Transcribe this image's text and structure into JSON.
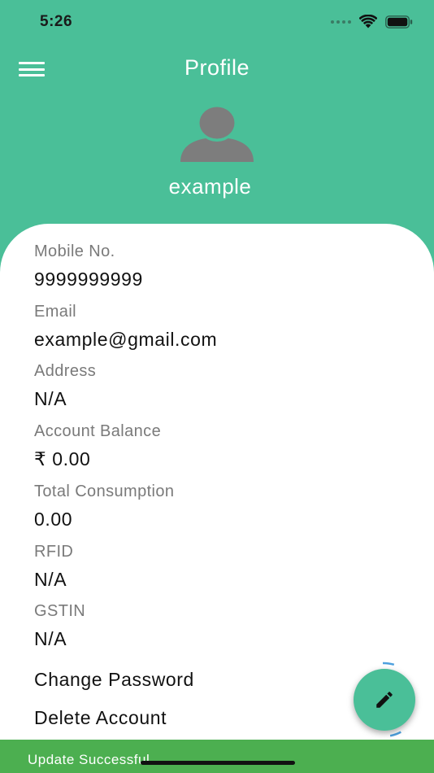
{
  "status_bar": {
    "time": "5:26"
  },
  "header": {
    "title": "Profile"
  },
  "user": {
    "name": "example"
  },
  "fields": [
    {
      "label": "Mobile No.",
      "value": "9999999999"
    },
    {
      "label": "Email",
      "value": "example@gmail.com"
    },
    {
      "label": "Address",
      "value": "N/A"
    },
    {
      "label": "Account Balance",
      "value": "₹ 0.00"
    },
    {
      "label": "Total Consumption",
      "value": "0.00"
    },
    {
      "label": "RFID",
      "value": "N/A"
    },
    {
      "label": "GSTIN",
      "value": "N/A"
    }
  ],
  "actions": {
    "change_password": "Change Password",
    "delete_account": "Delete Account"
  },
  "snackbar": {
    "message": "Update Successful"
  },
  "colors": {
    "primary": "#4abf98",
    "snackbar": "#4caf50",
    "avatar": "#7d7d7d"
  },
  "icons": {
    "menu": "hamburger-menu-icon",
    "avatar": "person-icon",
    "fab": "pencil-icon"
  }
}
